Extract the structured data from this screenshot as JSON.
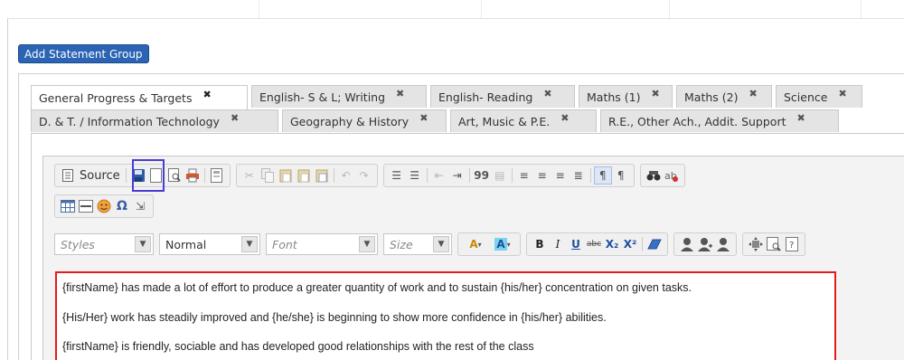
{
  "add_statement_group_label": "Add Statement Group",
  "tabs_row1": [
    {
      "label": "General Progress & Targets",
      "close": "✖"
    },
    {
      "label": "English- S & L; Writing",
      "close": "✖"
    },
    {
      "label": "English- Reading",
      "close": "✖"
    },
    {
      "label": "Maths (1)",
      "close": "✖"
    },
    {
      "label": "Maths (2)",
      "close": "✖"
    },
    {
      "label": "Science",
      "close": "✖"
    }
  ],
  "tabs_row2": [
    {
      "label": "D. & T. / Information Technology",
      "close": "✖"
    },
    {
      "label": "Geography & History",
      "close": "✖"
    },
    {
      "label": "Art, Music & P.E.",
      "close": "✖"
    },
    {
      "label": "R.E., Other Ach., Addit. Support",
      "close": "✖"
    }
  ],
  "toolbar": {
    "source_label": "Source",
    "styles_placeholder": "Styles",
    "format_value": "Normal",
    "font_placeholder": "Font",
    "size_placeholder": "Size",
    "bold": "B",
    "italic": "I",
    "underline": "U",
    "strike": "abc",
    "subscript": "X₂",
    "superscript": "X²",
    "quote": "99"
  },
  "content_lines": [
    "{firstName} has made a lot of effort to produce a greater quantity of work and to sustain {his/her} concentration on given tasks.",
    "{His/Her} work has steadily improved and {he/she} is beginning to show more confidence in {his/her} abilities.",
    "{firstName} is friendly, sociable and has developed good relationships with the rest of the class"
  ],
  "colors": {
    "accent": "#2b64b4",
    "highlight_border": "#4b3bd6",
    "content_border": "#e41b1b"
  }
}
